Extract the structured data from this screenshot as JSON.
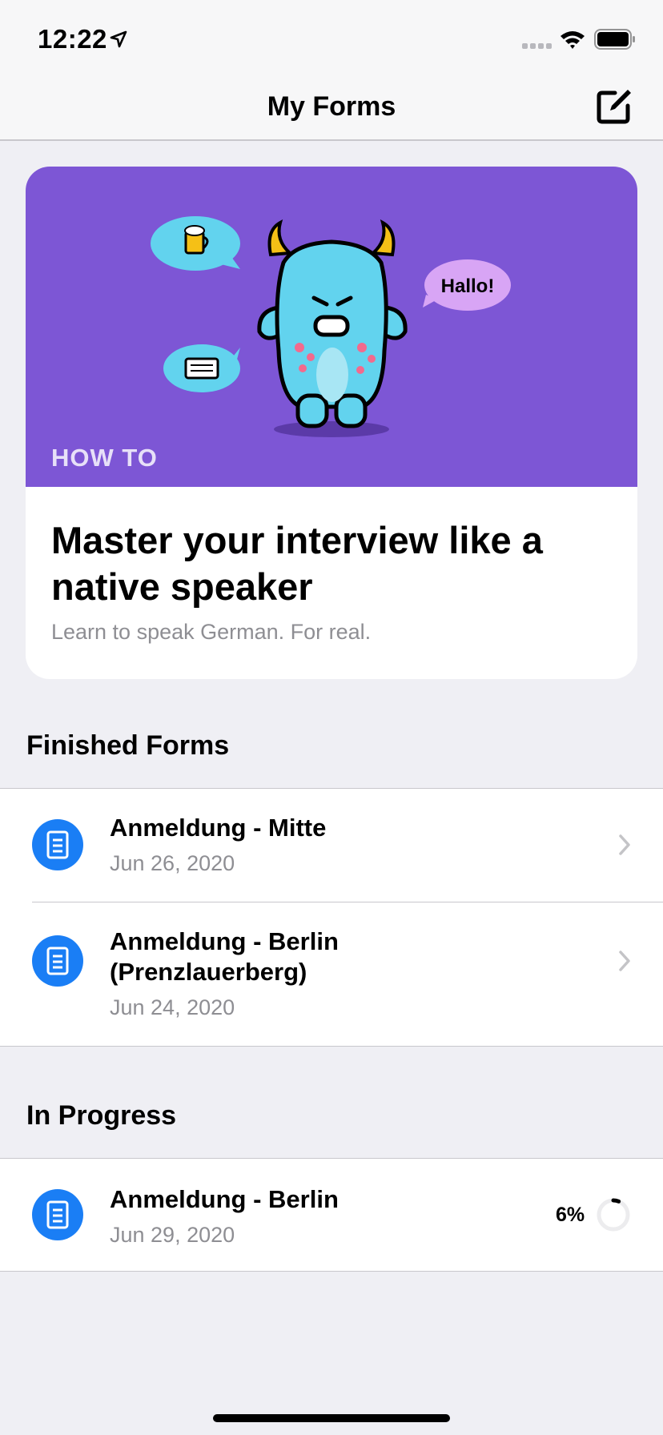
{
  "status_bar": {
    "time": "12:22"
  },
  "nav": {
    "title": "My Forms"
  },
  "card": {
    "eyebrow": "HOW TO",
    "bubble_text": "Hallo!",
    "title": "Master your interview like a native speaker",
    "subtitle": "Learn to speak German. For real.",
    "hero_color": "#7d56d5"
  },
  "finished": {
    "header": "Finished Forms",
    "items": [
      {
        "title": "Anmeldung - Mitte",
        "date": "Jun 26, 2020"
      },
      {
        "title": "Anmeldung - Berlin (Prenzlauerberg)",
        "date": "Jun 24, 2020"
      }
    ]
  },
  "in_progress": {
    "header": "In Progress",
    "items": [
      {
        "title": "Anmeldung - Berlin",
        "date": "Jun 29, 2020",
        "progress_label": "6%",
        "progress": 0.06
      }
    ]
  },
  "colors": {
    "accent": "#1a7ef5",
    "background": "#efeff4",
    "secondary_text": "#8e8e93"
  },
  "icons": [
    "location-arrow-icon",
    "signal-icon",
    "wifi-icon",
    "battery-icon",
    "compose-icon",
    "document-icon",
    "chevron-right-icon",
    "progress-ring-icon"
  ]
}
